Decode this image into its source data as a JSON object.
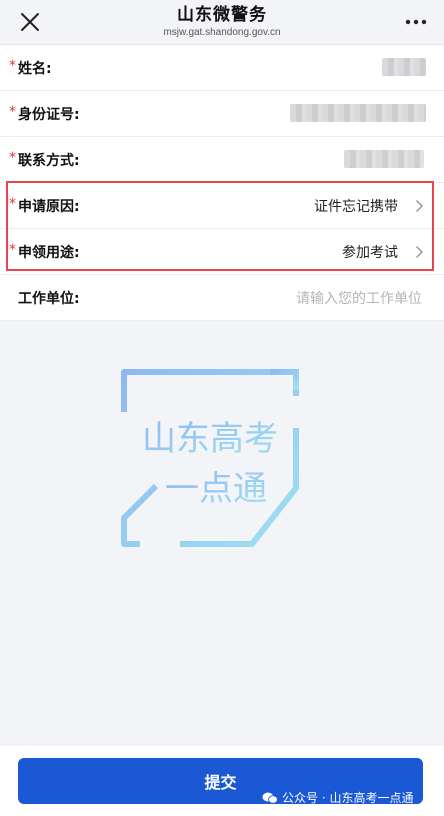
{
  "header": {
    "title": "山东微警务",
    "subtitle": "msjw.gat.shandong.gov.cn",
    "close_icon": "close-icon",
    "more_icon": "more-dots-icon"
  },
  "form": {
    "required_mark": "*",
    "rows": [
      {
        "label": "姓名:",
        "required": true,
        "value": ""
      },
      {
        "label": "身份证号:",
        "required": true,
        "value": ""
      },
      {
        "label": "联系方式:",
        "required": true,
        "value": ""
      },
      {
        "label": "申请原因:",
        "required": true,
        "value": "证件忘记携带"
      },
      {
        "label": "申领用途:",
        "required": true,
        "value": "参加考试"
      },
      {
        "label": "工作单位:",
        "required": false,
        "placeholder": "请输入您的工作单位"
      }
    ]
  },
  "logo": {
    "text_line1": "山东高考",
    "text_line2": "一点通"
  },
  "submit": {
    "label": "提交"
  },
  "watermark": {
    "text": "公众号 · 山东高考一点通"
  },
  "colors": {
    "primary": "#1a58d6",
    "required": "#e0353b",
    "highlight": "#e8444d",
    "background": "#f3f4f8"
  }
}
